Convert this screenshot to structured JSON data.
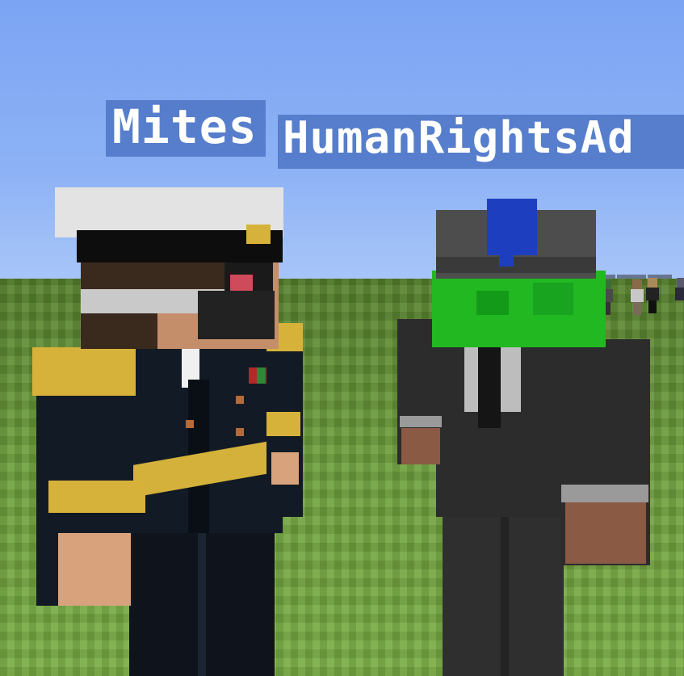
{
  "scene": {
    "game": "Minecraft",
    "sky_color": "#8db2f5",
    "grass_color": "#6d9f3c"
  },
  "players": [
    {
      "name": "Mites",
      "outfit": "naval officer uniform with white cap and gold epaulettes",
      "colors": {
        "uniform": "#101822",
        "gold": "#d7b23a",
        "cap": "#e2e2e2"
      }
    },
    {
      "name": "HumanRightsAd",
      "outfit": "dark suit with grey cap and green bandana mask",
      "colors": {
        "suit": "#2b2b2b",
        "mask": "#22b822",
        "feather": "#1d3fbf"
      }
    }
  ],
  "background_players": {
    "count": 6
  }
}
